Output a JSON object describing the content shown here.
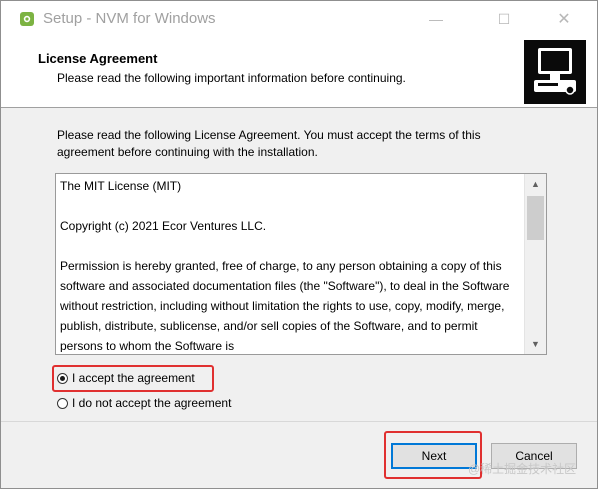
{
  "window": {
    "title": "Setup - NVM for Windows",
    "icon": "nvm-setup-icon"
  },
  "header": {
    "title": "License Agreement",
    "subtitle": "Please read the following important information before continuing.",
    "graphic": "setup-computer-graphic"
  },
  "body": {
    "intro": "Please read the following License Agreement. You must accept the terms of this agreement before continuing with the installation.",
    "license_lines": [
      "The MIT License (MIT)",
      "Copyright (c) 2021 Ecor Ventures LLC.",
      "Permission is hereby granted, free of charge, to any person obtaining a copy of this software and associated documentation files (the \"Software\"), to deal in the Software without restriction, including without limitation the rights to use, copy, modify, merge, publish, distribute, sublicense, and/or sell copies of the Software, and to permit persons to whom the Software is"
    ]
  },
  "options": {
    "accept_label": "I accept the agreement",
    "decline_label": "I do not accept the agreement",
    "selected": "accept"
  },
  "buttons": {
    "next_label": "Next",
    "cancel_label": "Cancel"
  },
  "watermark": "@稀土掘金技术社区",
  "colors": {
    "highlight": "#e03030",
    "focus": "#0078d7"
  }
}
